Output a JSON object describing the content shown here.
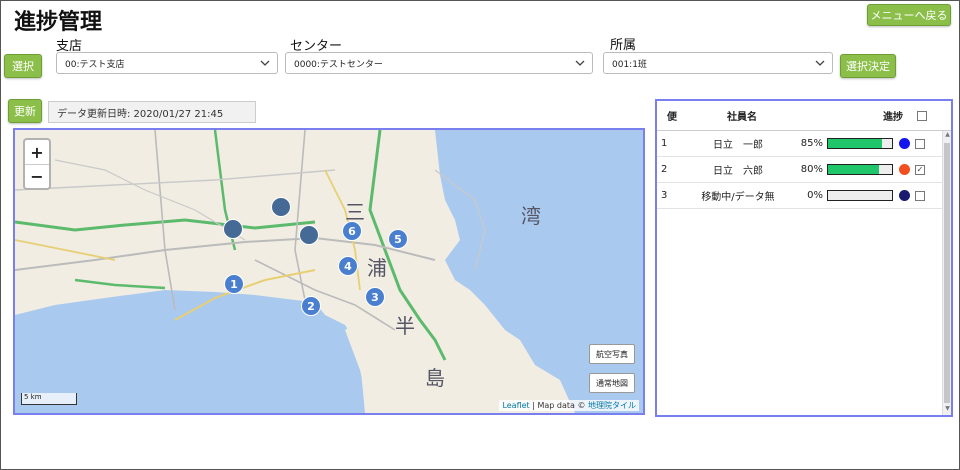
{
  "header": {
    "title": "進捗管理",
    "menu_back": "メニューへ戻る"
  },
  "filters": {
    "select_button": "選択",
    "branch": {
      "label": "支店",
      "value": "00:テスト支店"
    },
    "center": {
      "label": "センター",
      "value": "0000:テストセンター"
    },
    "affiliation": {
      "label": "所属",
      "value": "001:1班"
    },
    "confirm_button": "選択決定"
  },
  "refresh": {
    "button": "更新",
    "updated_text": "データ更新日時: 2020/01/27 21:45"
  },
  "map": {
    "zoom_in": "+",
    "zoom_out": "−",
    "markers": [
      "1",
      "2",
      "3",
      "4",
      "5",
      "6"
    ],
    "kanji": [
      "三",
      "浦",
      "半",
      "島",
      "湾"
    ],
    "aerial_button": "航空写真",
    "normal_button": "通常地図",
    "scale": "5 km",
    "attribution": {
      "leaflet": "Leaflet",
      "mapdata": " | Map data © ",
      "gsi": "地理院タイル"
    }
  },
  "table": {
    "headers": {
      "bin": "便",
      "name": "社員名",
      "progress": "進捗"
    },
    "rows": [
      {
        "bin": "1",
        "name": "日立　一郎",
        "percent": "85%",
        "progress": 0.85,
        "color": "#1515f0",
        "checked": false
      },
      {
        "bin": "2",
        "name": "日立　六郎",
        "percent": "80%",
        "progress": 0.8,
        "color": "#f05020",
        "checked": true
      },
      {
        "bin": "3",
        "name": "移動中/データ無",
        "percent": "0%",
        "progress": 0.0,
        "color": "#1a1a6e",
        "checked": false
      }
    ]
  },
  "colors": {
    "accent_green": "#8bbf4a",
    "panel_border": "#7a7ff0",
    "progress_fill": "#1fc66a",
    "marker_blue": "#4a7fcf"
  }
}
